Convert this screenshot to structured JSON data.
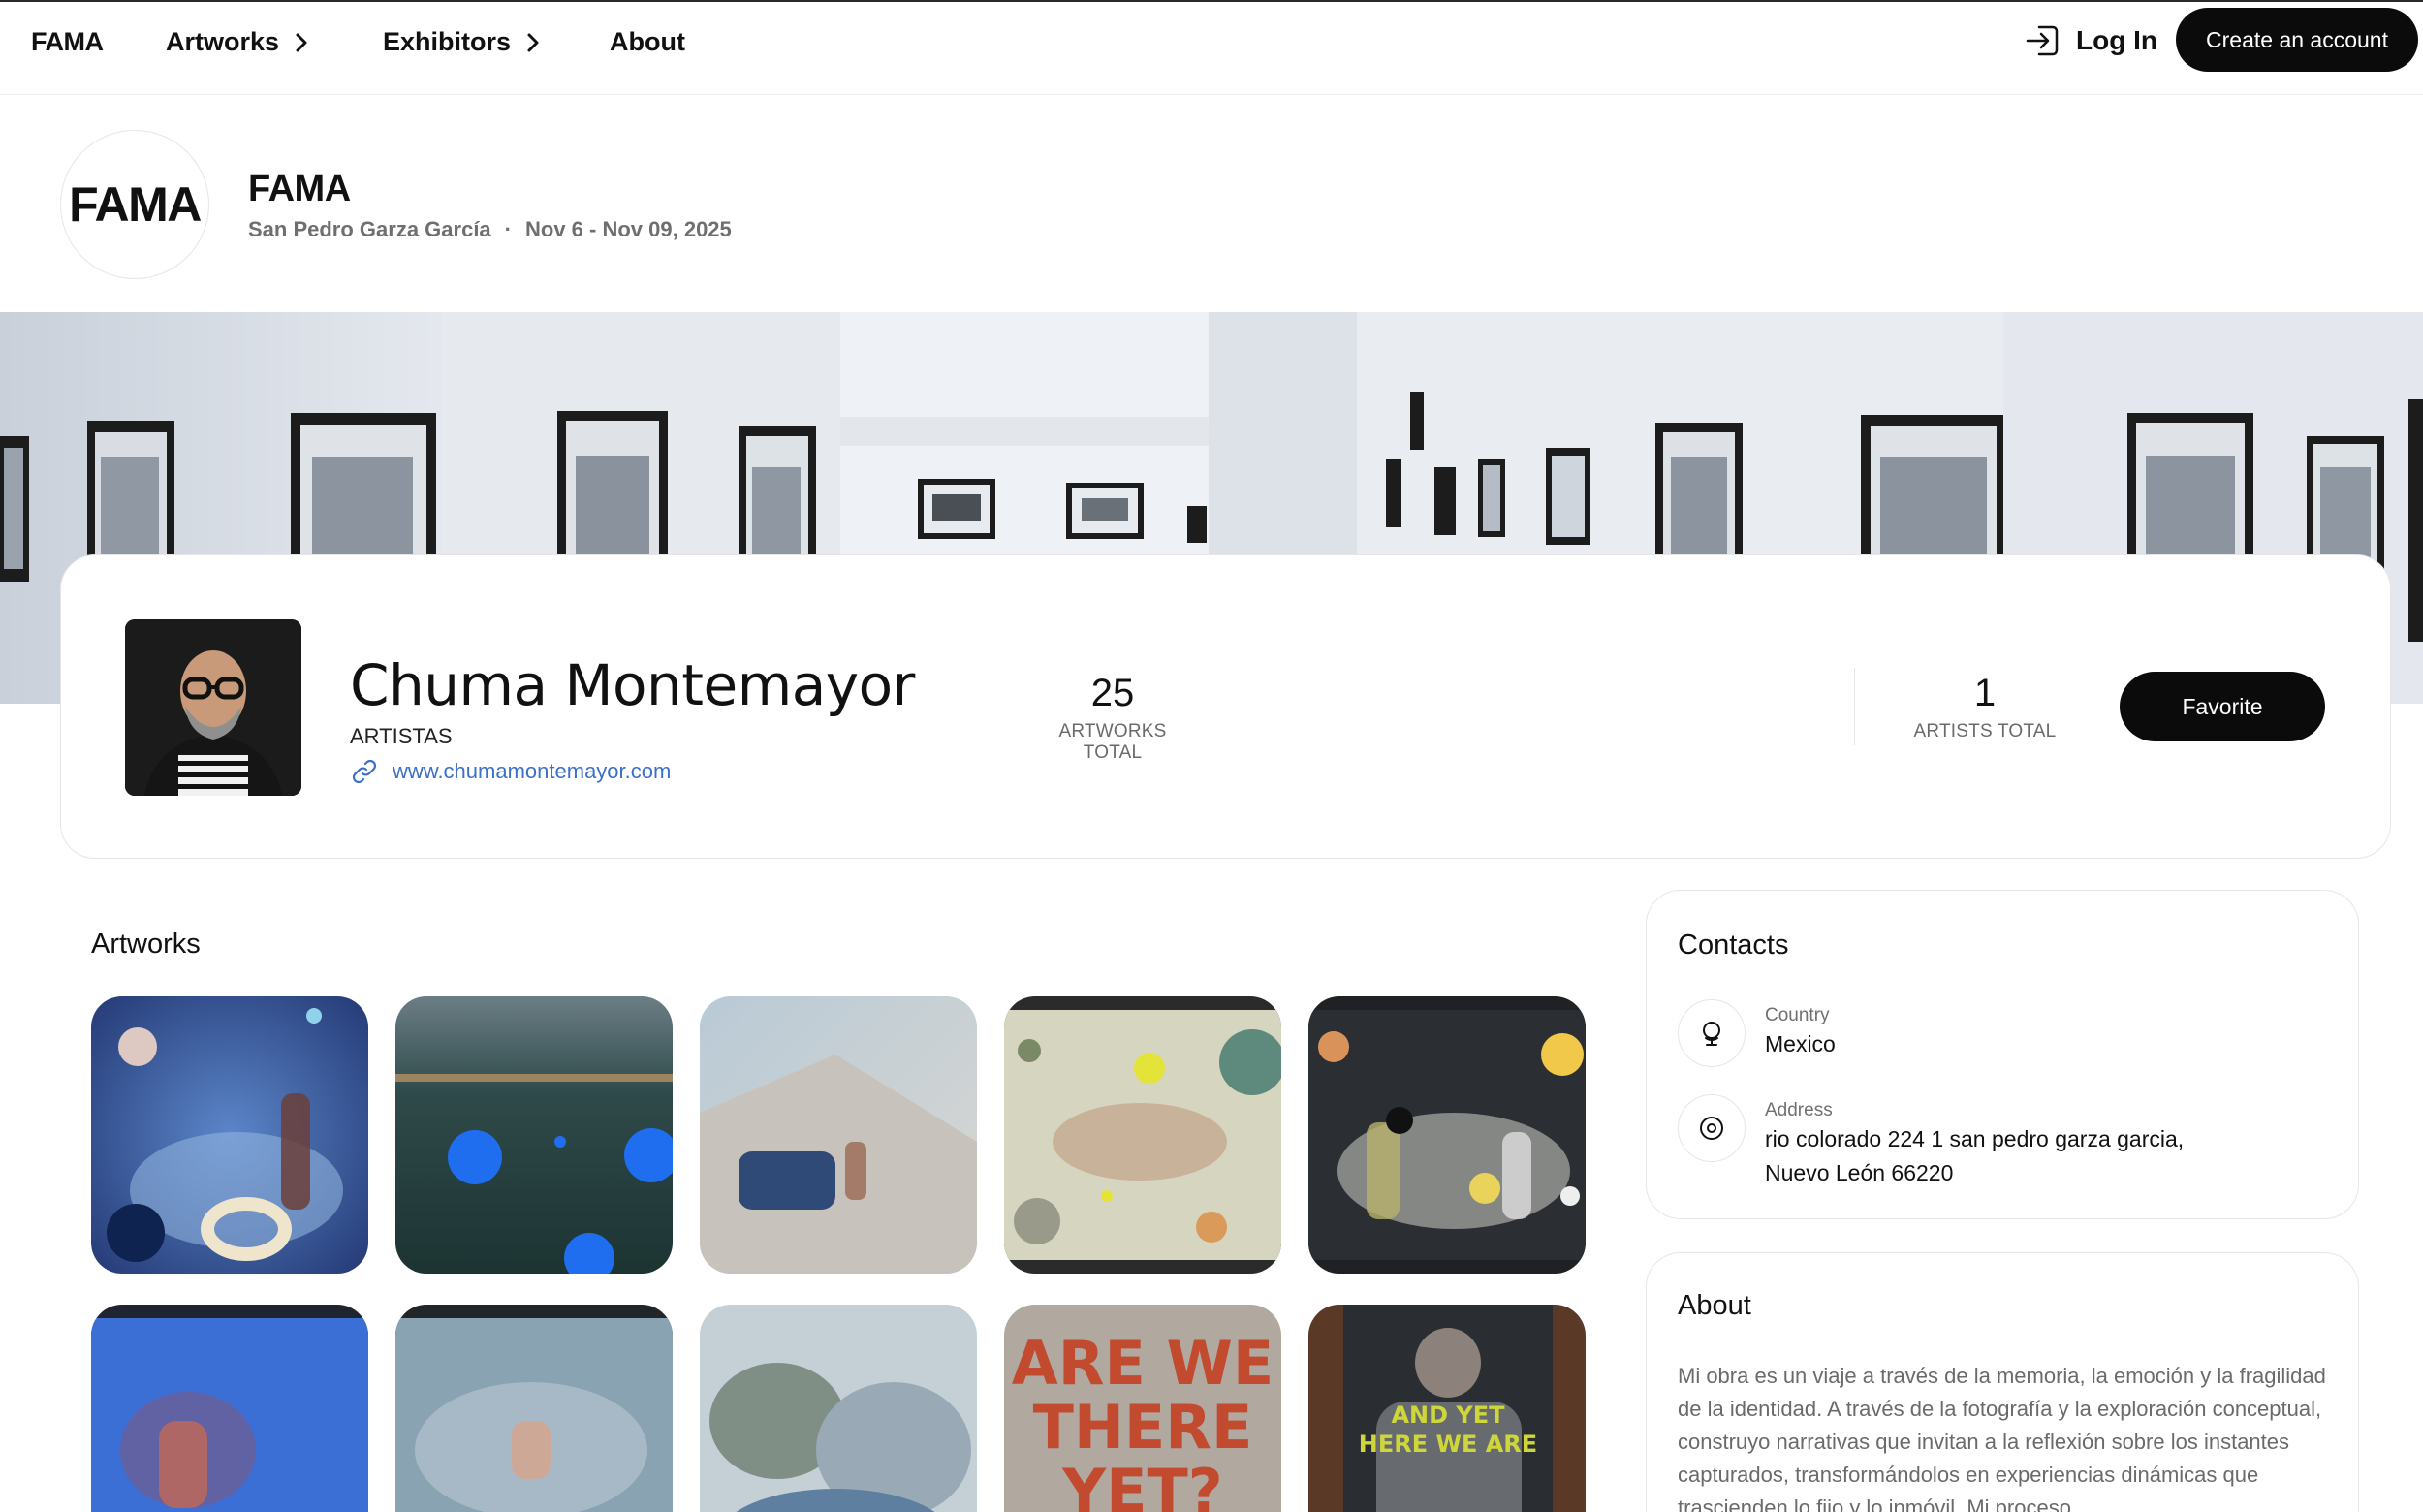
{
  "nav": {
    "brand": "FAMA",
    "items": [
      {
        "label": "Artworks"
      },
      {
        "label": "Exhibitors"
      },
      {
        "label": "About"
      }
    ],
    "login_label": "Log In",
    "create_account_label": "Create an account"
  },
  "fair": {
    "logo_text": "FAMA",
    "name": "FAMA",
    "location": "San Pedro Garza García",
    "separator": "·",
    "dates": "Nov 6 - Nov 09, 2025"
  },
  "profile": {
    "name": "Chuma Montemayor",
    "role": "ARTISTAS",
    "website": "www.chumamontemayor.com",
    "stats": [
      {
        "value": "25",
        "label": "ARTWORKS TOTAL"
      },
      {
        "value": "1",
        "label": "ARTISTS TOTAL"
      }
    ],
    "favorite_label": "Favorite"
  },
  "artworks": {
    "title": "Artworks",
    "tile_texts": {
      "are_we_there_yet": [
        "ARE WE",
        "THERE",
        "YET?"
      ],
      "and_yet_here_we_are": [
        "AND YET",
        "HERE WE ARE"
      ]
    }
  },
  "contacts": {
    "title": "Contacts",
    "country_label": "Country",
    "country_value": "Mexico",
    "address_label": "Address",
    "address_line1": "rio colorado 224 1 san pedro garza garcia,",
    "address_line2": "Nuevo León 66220"
  },
  "about": {
    "title": "About",
    "text": "Mi obra es un viaje a través de la memoria, la emoción y la fragilidad de la identidad. A través de la fotografía y la exploración conceptual, construyo narrativas que invitan a la reflexión sobre los instantes capturados, transformándolos en experiencias dinámicas que trascienden lo fijo y lo inmóvil. Mi proceso"
  },
  "colors": {
    "accent": "#0b0b0b",
    "link": "#3b6fc8",
    "muted": "#6a6a6a"
  },
  "icons": [
    "chevron-right-icon",
    "login-icon",
    "link-icon",
    "globe-icon",
    "location-pin-icon"
  ]
}
